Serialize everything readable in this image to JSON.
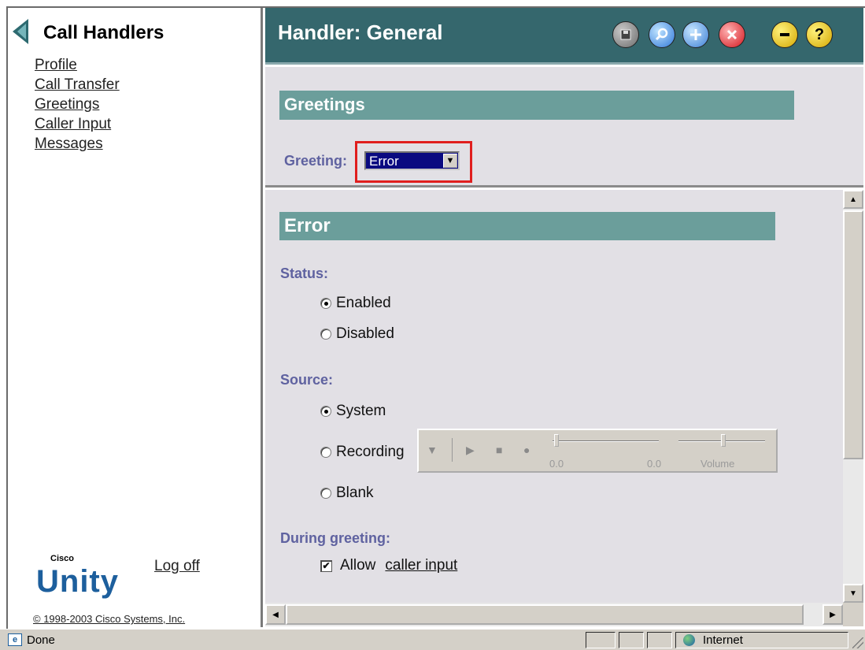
{
  "nav": {
    "title": "Call Handlers",
    "links": [
      "Profile",
      "Call Transfer",
      "Greetings",
      "Caller Input",
      "Messages"
    ],
    "logo_small": "Cisco",
    "logo_large": "Unity",
    "logoff": "Log off",
    "copyright": "© 1998-2003 Cisco Systems, Inc."
  },
  "header": {
    "title": "Handler: General",
    "buttons": {
      "save": "save-icon",
      "find": "search-icon",
      "add": "add-icon",
      "delete": "delete-icon",
      "minimize": "minimize-icon",
      "help": "?"
    }
  },
  "greetings_panel": {
    "section_title": "Greetings",
    "greeting_label": "Greeting:",
    "greeting_value": "Error"
  },
  "detail": {
    "section_title": "Error",
    "status": {
      "label": "Status:",
      "options": [
        "Enabled",
        "Disabled"
      ],
      "selected": "Enabled"
    },
    "source": {
      "label": "Source:",
      "options": [
        "System",
        "Recording",
        "Blank"
      ],
      "selected": "System"
    },
    "recorder": {
      "position_label": "0.0",
      "length_label": "0.0",
      "volume_label": "Volume"
    },
    "during_greeting": {
      "label": "During greeting:",
      "allow_label": "Allow",
      "caller_input_link": "caller input",
      "allow_checked": true
    }
  },
  "status_bar": {
    "text": "Done",
    "zone": "Internet"
  },
  "colors": {
    "header_bg": "#35676d",
    "section_bar": "#6b9e9b",
    "label_color": "#5f62a0",
    "panel_bg": "#e2e0e5",
    "highlight_border": "#e01e1e",
    "logo_blue": "#1d5f9d"
  }
}
